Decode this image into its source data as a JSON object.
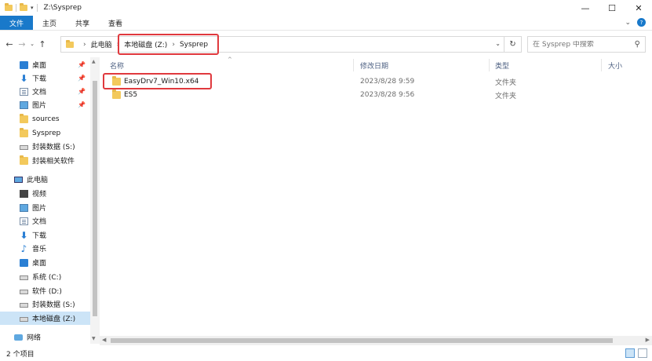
{
  "window": {
    "title": "Z:\\Sysprep",
    "minimize": "—",
    "maximize": "☐",
    "close": "✕"
  },
  "ribbon": {
    "tabs": [
      "文件",
      "主页",
      "共享",
      "查看"
    ],
    "expand": "⌄",
    "help": "?"
  },
  "nav": {
    "back": "←",
    "forward": "→",
    "recent": "⌄",
    "up": "↑"
  },
  "address": {
    "crumbs": [
      "此电脑",
      "本地磁盘 (Z:)",
      "Sysprep"
    ],
    "sep": "›",
    "dropdown": "⌄",
    "refresh": "↻"
  },
  "search": {
    "placeholder": "在 Sysprep 中搜索",
    "icon": "⚲"
  },
  "sidebar": {
    "pin": "📌",
    "items": [
      {
        "label": "桌面",
        "icon": "desktop-icon",
        "pinned": true
      },
      {
        "label": "下载",
        "icon": "download-icon",
        "pinned": true
      },
      {
        "label": "文档",
        "icon": "document-icon",
        "pinned": true
      },
      {
        "label": "图片",
        "icon": "picture-icon",
        "pinned": true
      },
      {
        "label": "sources",
        "icon": "folder-icon"
      },
      {
        "label": "Sysprep",
        "icon": "folder-icon"
      },
      {
        "label": "封装数据 (S:)",
        "icon": "drive-icon"
      },
      {
        "label": "封装相关软件",
        "icon": "folder-icon"
      },
      {
        "label": "此电脑",
        "icon": "pc-icon"
      },
      {
        "label": "视频",
        "icon": "video-icon"
      },
      {
        "label": "图片",
        "icon": "picture-icon"
      },
      {
        "label": "文档",
        "icon": "document-icon"
      },
      {
        "label": "下载",
        "icon": "download-icon"
      },
      {
        "label": "音乐",
        "icon": "music-icon"
      },
      {
        "label": "桌面",
        "icon": "desktop-icon"
      },
      {
        "label": "系统 (C:)",
        "icon": "drive-icon"
      },
      {
        "label": "软件 (D:)",
        "icon": "drive-icon"
      },
      {
        "label": "封装数据 (S:)",
        "icon": "drive-icon"
      },
      {
        "label": "本地磁盘 (Z:)",
        "icon": "drive-icon",
        "selected": true
      },
      {
        "label": "网络",
        "icon": "network-icon"
      }
    ]
  },
  "columns": {
    "name": "名称",
    "date": "修改日期",
    "type": "类型",
    "size": "大小",
    "sort": "^"
  },
  "files": [
    {
      "name": "EasyDrv7_Win10.x64",
      "date": "2023/8/28 9:59",
      "type": "文件夹"
    },
    {
      "name": "ES5",
      "date": "2023/8/28 9:56",
      "type": "文件夹"
    }
  ],
  "status": {
    "count": "2 个项目"
  },
  "colors": {
    "accent": "#1979ca",
    "highlight": "#e0393e",
    "selected": "#cce4f7"
  }
}
